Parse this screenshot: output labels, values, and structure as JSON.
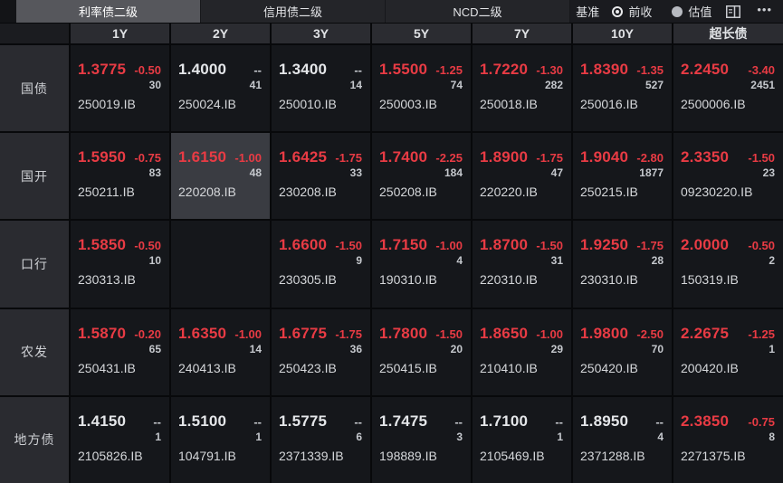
{
  "tabs": [
    {
      "name": "tab-rate-bond-secondary",
      "label": "利率债二级",
      "selected": true
    },
    {
      "name": "tab-credit-bond-secondary",
      "label": "信用债二级",
      "selected": false
    },
    {
      "name": "tab-ncd-secondary",
      "label": "NCD二级",
      "selected": false
    }
  ],
  "benchmark": {
    "label": "基准",
    "options": [
      {
        "name": "radio-prev-close",
        "label": "前收",
        "selected": true
      },
      {
        "name": "radio-valuation",
        "label": "估值",
        "selected": false
      }
    ]
  },
  "icons": {
    "layout": "layout-panel-icon",
    "more": "•••"
  },
  "colors": {
    "down_red": "#e83b44",
    "flat_white": "#e4e6e9",
    "selected_tab_bg": "#56575c",
    "cell_bg": "#15171b",
    "highlight_cell_bg": "#3a3c42"
  },
  "table": {
    "columns": [
      "1Y",
      "2Y",
      "3Y",
      "5Y",
      "7Y",
      "10Y",
      "超长债"
    ],
    "rows": [
      {
        "name": "row-treasury",
        "label": "国债",
        "cells": [
          {
            "rate": "1.3775",
            "change": "-0.50",
            "volume": "30",
            "code": "250019.IB",
            "down": true
          },
          {
            "rate": "1.4000",
            "change": "--",
            "volume": "41",
            "code": "250024.IB",
            "down": false
          },
          {
            "rate": "1.3400",
            "change": "--",
            "volume": "14",
            "code": "250010.IB",
            "down": false
          },
          {
            "rate": "1.5500",
            "change": "-1.25",
            "volume": "74",
            "code": "250003.IB",
            "down": true
          },
          {
            "rate": "1.7220",
            "change": "-1.30",
            "volume": "282",
            "code": "250018.IB",
            "down": true
          },
          {
            "rate": "1.8390",
            "change": "-1.35",
            "volume": "527",
            "code": "250016.IB",
            "down": true
          },
          {
            "rate": "2.2450",
            "change": "-3.40",
            "volume": "2451",
            "code": "2500006.IB",
            "down": true
          }
        ]
      },
      {
        "name": "row-cdb",
        "label": "国开",
        "cells": [
          {
            "rate": "1.5950",
            "change": "-0.75",
            "volume": "83",
            "code": "250211.IB",
            "down": true
          },
          {
            "rate": "1.6150",
            "change": "-1.00",
            "volume": "48",
            "code": "220208.IB",
            "down": true,
            "highlight": true
          },
          {
            "rate": "1.6425",
            "change": "-1.75",
            "volume": "33",
            "code": "230208.IB",
            "down": true
          },
          {
            "rate": "1.7400",
            "change": "-2.25",
            "volume": "184",
            "code": "250208.IB",
            "down": true
          },
          {
            "rate": "1.8900",
            "change": "-1.75",
            "volume": "47",
            "code": "220220.IB",
            "down": true
          },
          {
            "rate": "1.9040",
            "change": "-2.80",
            "volume": "1877",
            "code": "250215.IB",
            "down": true
          },
          {
            "rate": "2.3350",
            "change": "-1.50",
            "volume": "23",
            "code": "09230220.IB",
            "down": true
          }
        ]
      },
      {
        "name": "row-exim",
        "label": "口行",
        "cells": [
          {
            "rate": "1.5850",
            "change": "-0.50",
            "volume": "10",
            "code": "230313.IB",
            "down": true
          },
          null,
          {
            "rate": "1.6600",
            "change": "-1.50",
            "volume": "9",
            "code": "230305.IB",
            "down": true
          },
          {
            "rate": "1.7150",
            "change": "-1.00",
            "volume": "4",
            "code": "190310.IB",
            "down": true
          },
          {
            "rate": "1.8700",
            "change": "-1.50",
            "volume": "31",
            "code": "220310.IB",
            "down": true
          },
          {
            "rate": "1.9250",
            "change": "-1.75",
            "volume": "28",
            "code": "230310.IB",
            "down": true
          },
          {
            "rate": "2.0000",
            "change": "-0.50",
            "volume": "2",
            "code": "150319.IB",
            "down": true
          }
        ]
      },
      {
        "name": "row-adbc",
        "label": "农发",
        "cells": [
          {
            "rate": "1.5870",
            "change": "-0.20",
            "volume": "65",
            "code": "250431.IB",
            "down": true
          },
          {
            "rate": "1.6350",
            "change": "-1.00",
            "volume": "14",
            "code": "240413.IB",
            "down": true
          },
          {
            "rate": "1.6775",
            "change": "-1.75",
            "volume": "36",
            "code": "250423.IB",
            "down": true
          },
          {
            "rate": "1.7800",
            "change": "-1.50",
            "volume": "20",
            "code": "250415.IB",
            "down": true
          },
          {
            "rate": "1.8650",
            "change": "-1.00",
            "volume": "29",
            "code": "210410.IB",
            "down": true
          },
          {
            "rate": "1.9800",
            "change": "-2.50",
            "volume": "70",
            "code": "250420.IB",
            "down": true
          },
          {
            "rate": "2.2675",
            "change": "-1.25",
            "volume": "1",
            "code": "200420.IB",
            "down": true
          }
        ]
      },
      {
        "name": "row-local-gov",
        "label": "地方债",
        "cells": [
          {
            "rate": "1.4150",
            "change": "--",
            "volume": "1",
            "code": "2105826.IB",
            "down": false
          },
          {
            "rate": "1.5100",
            "change": "--",
            "volume": "1",
            "code": "104791.IB",
            "down": false
          },
          {
            "rate": "1.5775",
            "change": "--",
            "volume": "6",
            "code": "2371339.IB",
            "down": false
          },
          {
            "rate": "1.7475",
            "change": "--",
            "volume": "3",
            "code": "198889.IB",
            "down": false
          },
          {
            "rate": "1.7100",
            "change": "--",
            "volume": "1",
            "code": "2105469.IB",
            "down": false
          },
          {
            "rate": "1.8950",
            "change": "--",
            "volume": "4",
            "code": "2371288.IB",
            "down": false
          },
          {
            "rate": "2.3850",
            "change": "-0.75",
            "volume": "8",
            "code": "2271375.IB",
            "down": true
          }
        ]
      }
    ]
  }
}
